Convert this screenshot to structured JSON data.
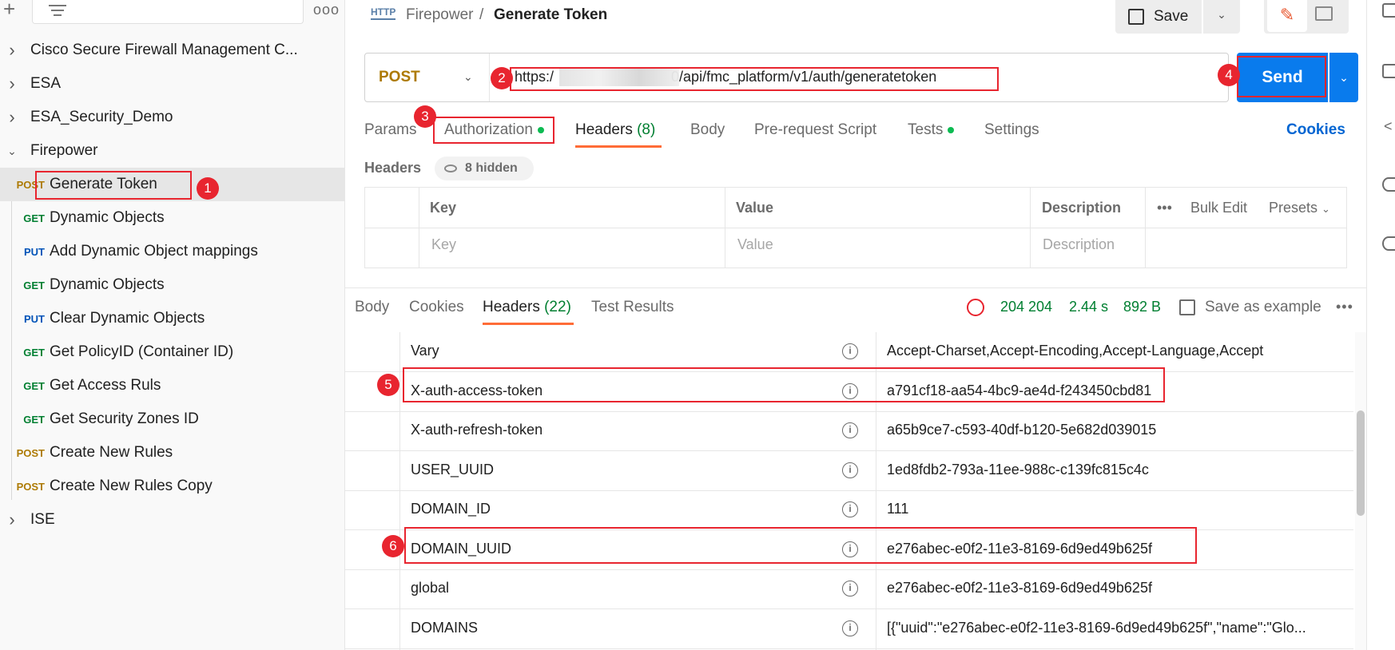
{
  "sidebar": {
    "more_label": "ooo",
    "items": [
      {
        "kind": "folder",
        "label": "Cisco Secure Firewall Management C...",
        "expanded": false
      },
      {
        "kind": "folder",
        "label": "ESA",
        "expanded": false
      },
      {
        "kind": "folder",
        "label": "ESA_Security_Demo",
        "expanded": false
      },
      {
        "kind": "folder",
        "label": "Firepower",
        "expanded": true
      },
      {
        "kind": "request",
        "method": "POST",
        "label": "Generate Token",
        "selected": true
      },
      {
        "kind": "request",
        "method": "GET",
        "label": "Dynamic Objects"
      },
      {
        "kind": "request",
        "method": "PUT",
        "label": "Add Dynamic Object mappings"
      },
      {
        "kind": "request",
        "method": "GET",
        "label": "Dynamic Objects"
      },
      {
        "kind": "request",
        "method": "PUT",
        "label": "Clear Dynamic Objects"
      },
      {
        "kind": "request",
        "method": "GET",
        "label": "Get PolicyID (Container ID)"
      },
      {
        "kind": "request",
        "method": "GET",
        "label": "Get Access Ruls"
      },
      {
        "kind": "request",
        "method": "GET",
        "label": "Get Security Zones ID"
      },
      {
        "kind": "request",
        "method": "POST",
        "label": "Create New Rules"
      },
      {
        "kind": "request",
        "method": "POST",
        "label": "Create New Rules Copy"
      },
      {
        "kind": "folder",
        "label": "ISE",
        "expanded": false
      }
    ]
  },
  "header": {
    "http_icon_label": "HTTP",
    "breadcrumb_parent": "Firepower",
    "breadcrumb_sep": "/",
    "breadcrumb_current": "Generate Token",
    "save_label": "Save"
  },
  "request": {
    "method": "POST",
    "url_prefix": "https:/",
    "url_suffix": "0/api/fmc_platform/v1/auth/generatetoken",
    "send_label": "Send",
    "tabs": [
      {
        "label": "Params"
      },
      {
        "label": "Authorization",
        "dot": true
      },
      {
        "label": "Headers",
        "count": "(8)",
        "active": true
      },
      {
        "label": "Body"
      },
      {
        "label": "Pre-request Script"
      },
      {
        "label": "Tests",
        "dot": true
      },
      {
        "label": "Settings"
      }
    ],
    "cookies_label": "Cookies",
    "headers_label": "Headers",
    "hidden_label": "8 hidden",
    "table": {
      "col_key": "Key",
      "col_value": "Value",
      "col_description": "Description",
      "more": "•••",
      "bulk_edit": "Bulk Edit",
      "presets": "Presets",
      "ph_key": "Key",
      "ph_value": "Value",
      "ph_description": "Description"
    }
  },
  "response": {
    "tabs": [
      {
        "label": "Body"
      },
      {
        "label": "Cookies"
      },
      {
        "label": "Headers",
        "count": "(22)",
        "active": true
      },
      {
        "label": "Test Results"
      }
    ],
    "status": "204 204",
    "time": "2.44 s",
    "size": "892 B",
    "save_example": "Save as example",
    "more": "•••",
    "headers": [
      {
        "key": "Vary",
        "value": "Accept-Charset,Accept-Encoding,Accept-Language,Accept"
      },
      {
        "key": "X-auth-access-token",
        "value": "a791cf18-aa54-4bc9-ae4d-f243450cbd81"
      },
      {
        "key": "X-auth-refresh-token",
        "value": "a65b9ce7-c593-40df-b120-5e682d039015"
      },
      {
        "key": "USER_UUID",
        "value": "1ed8fdb2-793a-11ee-988c-c139fc815c4c"
      },
      {
        "key": "DOMAIN_ID",
        "value": "111"
      },
      {
        "key": "DOMAIN_UUID",
        "value": "e276abec-e0f2-11e3-8169-6d9ed49b625f"
      },
      {
        "key": "global",
        "value": "e276abec-e0f2-11e3-8169-6d9ed49b625f"
      },
      {
        "key": "DOMAINS",
        "value": "[{\"uuid\":\"e276abec-e0f2-11e3-8169-6d9ed49b625f\",\"name\":\"Glo..."
      }
    ]
  },
  "annotations": [
    "1",
    "2",
    "3",
    "4",
    "5",
    "6"
  ],
  "colors": {
    "accent": "#ff6c37",
    "send": "#097bed",
    "annotation": "#e8252f",
    "post": "#ad7a03",
    "get": "#007f31",
    "put": "#0053b8"
  }
}
